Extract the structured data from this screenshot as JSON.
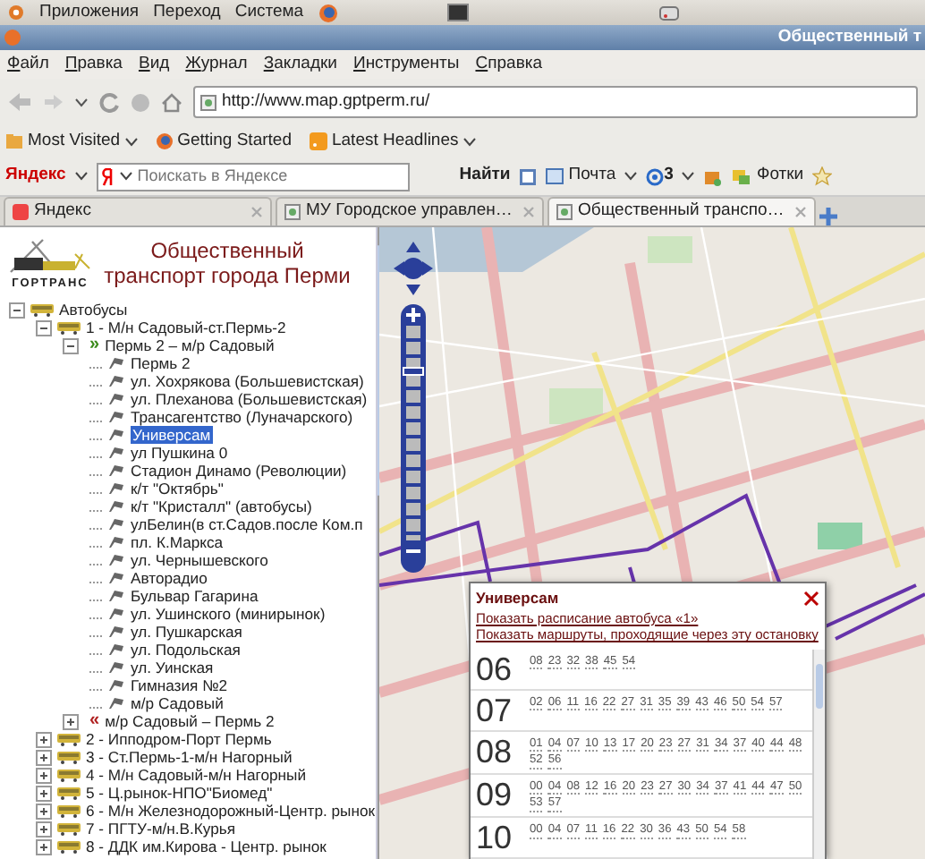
{
  "desktop_panel": {
    "menus": [
      "Приложения",
      "Переход",
      "Система"
    ]
  },
  "window": {
    "title": "Общественный т"
  },
  "menu_bar": [
    "Файл",
    "Правка",
    "Вид",
    "Журнал",
    "Закладки",
    "Инструменты",
    "Справка"
  ],
  "address_bar": {
    "url": "http://www.map.gptperm.ru/"
  },
  "bookmarks": [
    {
      "label": "Most Visited",
      "dropdown": true
    },
    {
      "label": "Getting Started",
      "dropdown": false
    },
    {
      "label": "Latest Headlines",
      "dropdown": true
    }
  ],
  "yandex_toolbar": {
    "brand": "Яндекс",
    "search_placeholder": "Поискать в Яндексе",
    "search_button": "Найти",
    "mail": "Почта",
    "mail_count": "3",
    "photos": "Фотки"
  },
  "tabs": [
    {
      "label": "Яндекс",
      "selected": false
    },
    {
      "label": "МУ Городское управлен…",
      "selected": false
    },
    {
      "label": "Общественный транспо…",
      "selected": true
    }
  ],
  "site": {
    "title": "Общественный транспорт города Перми",
    "logo_text": "ГОРТРАНС"
  },
  "tree": [
    {
      "kind": "category",
      "label": "Автобусы",
      "expanded": true,
      "children": [
        {
          "kind": "route",
          "label": "1 - М/н Садовый-ст.Пермь-2",
          "expanded": true,
          "children": [
            {
              "kind": "direction",
              "arrow": "»",
              "label": "Пермь 2 – м/р Садовый",
              "expanded": true,
              "children": [
                {
                  "kind": "stop",
                  "label": "Пермь 2",
                  "selected": false
                },
                {
                  "kind": "stop",
                  "label": "ул. Хохрякова (Большевистская)",
                  "selected": false
                },
                {
                  "kind": "stop",
                  "label": "ул. Плеханова (Большевистская)",
                  "selected": false
                },
                {
                  "kind": "stop",
                  "label": "Трансагентство (Луначарского)",
                  "selected": false
                },
                {
                  "kind": "stop",
                  "label": "Универсам",
                  "selected": true
                },
                {
                  "kind": "stop",
                  "label": "ул Пушкина 0",
                  "selected": false
                },
                {
                  "kind": "stop",
                  "label": "Стадион Динамо (Революции)",
                  "selected": false
                },
                {
                  "kind": "stop",
                  "label": "к/т \"Октябрь\"",
                  "selected": false
                },
                {
                  "kind": "stop",
                  "label": "к/т \"Кристалл\" (автобусы)",
                  "selected": false
                },
                {
                  "kind": "stop",
                  "label": "улБелин(в ст.Садов.после Ком.п",
                  "selected": false
                },
                {
                  "kind": "stop",
                  "label": "пл. К.Маркса",
                  "selected": false
                },
                {
                  "kind": "stop",
                  "label": "ул. Чернышевского",
                  "selected": false
                },
                {
                  "kind": "stop",
                  "label": "Авторадио",
                  "selected": false
                },
                {
                  "kind": "stop",
                  "label": "Бульвар Гагарина",
                  "selected": false
                },
                {
                  "kind": "stop",
                  "label": "ул. Ушинского (минирынок)",
                  "selected": false
                },
                {
                  "kind": "stop",
                  "label": "ул. Пушкарская",
                  "selected": false
                },
                {
                  "kind": "stop",
                  "label": "ул. Подольская",
                  "selected": false
                },
                {
                  "kind": "stop",
                  "label": "ул. Уинская",
                  "selected": false
                },
                {
                  "kind": "stop",
                  "label": "Гимназия №2",
                  "selected": false
                },
                {
                  "kind": "stop",
                  "label": "м/р Садовый",
                  "selected": false
                }
              ]
            },
            {
              "kind": "direction",
              "arrow": "«",
              "label": "м/р Садовый – Пермь 2",
              "expanded": false
            }
          ]
        },
        {
          "kind": "route",
          "label": "2 - Ипподром-Порт Пермь",
          "expanded": false
        },
        {
          "kind": "route",
          "label": "3 - Ст.Пермь-1-м/н Нагорный",
          "expanded": false
        },
        {
          "kind": "route",
          "label": "4 - М/н Садовый-м/н Нагорный",
          "expanded": false
        },
        {
          "kind": "route",
          "label": "5 - Ц.рынок-НПО\"Биомед\"",
          "expanded": false
        },
        {
          "kind": "route",
          "label": "6 - М/н Железнодорожный-Центр. рынок",
          "expanded": false
        },
        {
          "kind": "route",
          "label": "7 - ПГТУ-м/н.В.Курья",
          "expanded": false
        },
        {
          "kind": "route",
          "label": "8 - ДДК им.Кирова - Центр. рынок",
          "expanded": false
        }
      ]
    }
  ],
  "map": {
    "zoom": {
      "level": 0.8
    }
  },
  "popup": {
    "title": "Универсам",
    "links": [
      "Показать расписание автобуса «1»",
      "Показать маршруты, проходящие через эту остановку"
    ],
    "schedule": [
      {
        "hour": "06",
        "minutes": [
          "08",
          "23",
          "32",
          "38",
          "45",
          "54"
        ]
      },
      {
        "hour": "07",
        "minutes": [
          "02",
          "06",
          "11",
          "16",
          "22",
          "27",
          "31",
          "35",
          "39",
          "43",
          "46",
          "50",
          "54",
          "57"
        ]
      },
      {
        "hour": "08",
        "minutes": [
          "01",
          "04",
          "07",
          "10",
          "13",
          "17",
          "20",
          "23",
          "27",
          "31",
          "34",
          "37",
          "40",
          "44",
          "48",
          "52",
          "56"
        ]
      },
      {
        "hour": "09",
        "minutes": [
          "00",
          "04",
          "08",
          "12",
          "16",
          "20",
          "23",
          "27",
          "30",
          "34",
          "37",
          "41",
          "44",
          "47",
          "50",
          "53",
          "57"
        ]
      },
      {
        "hour": "10",
        "minutes": [
          "00",
          "04",
          "07",
          "11",
          "16",
          "22",
          "30",
          "36",
          "43",
          "50",
          "54",
          "58"
        ]
      }
    ]
  }
}
